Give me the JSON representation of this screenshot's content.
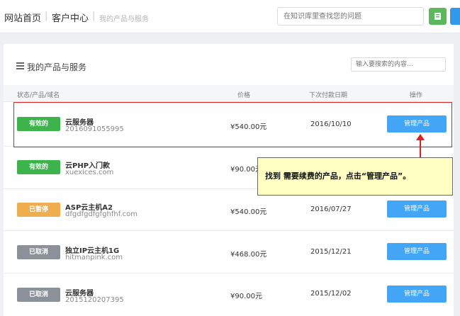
{
  "header": {
    "crumb_home": "网站首页",
    "separator": "|",
    "crumb_customer": "客户中心",
    "crumb_current": "我的产品与服务",
    "search_placeholder": "在知识库里查找您的问题"
  },
  "panel": {
    "title": "我的产品与服务",
    "search_placeholder": "输入要搜索的内容..."
  },
  "table": {
    "col_status": "状态/产品/域名",
    "col_price": "价格",
    "col_next_date": "下次付款日期",
    "col_action": "操作",
    "rows": [
      {
        "status": "有效的",
        "status_color": "#3cb44b",
        "name": "云服务器",
        "domain": "2016091055995",
        "price": "¥540.00元",
        "date": "2016/10/10",
        "action": "管理产品"
      },
      {
        "status": "有效的",
        "status_color": "#3cb44b",
        "name": "云PHP入门款",
        "domain": "xuexices.com",
        "price": "¥90.00元",
        "date": "",
        "action": ""
      },
      {
        "status": "已暂停",
        "status_color": "#f0ad4e",
        "name": "ASP云主机A2",
        "domain": "dfgdfgdfgfghfhf.com",
        "price": "¥540.00元",
        "date": "2016/07/27",
        "action": "管理产品"
      },
      {
        "status": "已取消",
        "status_color": "#8a9199",
        "name": "独立IP云主机1G",
        "domain": "hitmanpink.com",
        "price": "¥468.00元",
        "date": "2015/12/21",
        "action": "管理产品"
      },
      {
        "status": "已取消",
        "status_color": "#8a9199",
        "name": "云服务器",
        "domain": "2015120207395",
        "price": "¥90.00元",
        "date": "2015/12/02",
        "action": "管理产品"
      }
    ]
  },
  "callout": {
    "text": "找到 需要续费的产品，点击“管理产品”。"
  }
}
